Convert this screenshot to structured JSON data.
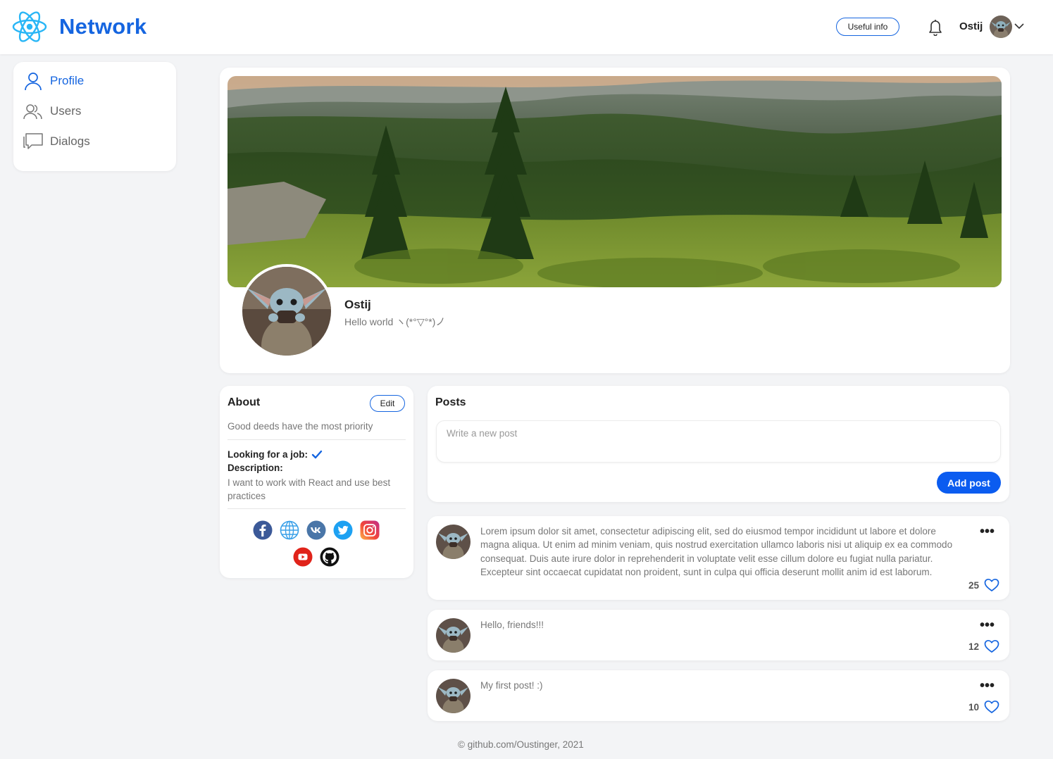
{
  "app": {
    "name": "Network"
  },
  "header": {
    "useful_info_label": "Useful info",
    "user_name": "Ostij"
  },
  "sidebar": {
    "items": [
      {
        "label": "Profile",
        "icon": "user-icon",
        "active": true
      },
      {
        "label": "Users",
        "icon": "users-icon",
        "active": false
      },
      {
        "label": "Dialogs",
        "icon": "chat-icon",
        "active": false
      }
    ]
  },
  "profile": {
    "name": "Ostij",
    "status": "Hello world  ヽ(*°▽°*)ノ"
  },
  "about": {
    "title": "About",
    "edit_label": "Edit",
    "about_me": "Good deeds have the most priority",
    "looking_for_job_label": "Looking for a job:",
    "looking_for_job": true,
    "description_label": "Description:",
    "description": "I want to work with React and use best practices",
    "socials": [
      "facebook-icon",
      "website-icon",
      "vk-icon",
      "twitter-icon",
      "instagram-icon",
      "youtube-icon",
      "github-icon"
    ]
  },
  "posts": {
    "title": "Posts",
    "input_placeholder": "Write a new post",
    "add_label": "Add post",
    "items": [
      {
        "text": "Lorem ipsum dolor sit amet, consectetur adipiscing elit, sed do eiusmod tempor incididunt ut labore et dolore magna aliqua. Ut enim ad minim veniam, quis nostrud exercitation ullamco laboris nisi ut aliquip ex ea commodo consequat. Duis aute irure dolor in reprehenderit in voluptate velit esse cillum dolore eu fugiat nulla pariatur. Excepteur sint occaecat cupidatat non proident, sunt in culpa qui officia deserunt mollit anim id est laborum.",
        "likes": "25"
      },
      {
        "text": "Hello, friends!!!",
        "likes": "12"
      },
      {
        "text": "My first post! :)",
        "likes": "10"
      }
    ]
  },
  "footer": {
    "text": "© github.com/Oustinger, 2021"
  },
  "colors": {
    "accent": "#1565e0",
    "button": "#0b5cf0",
    "background": "#f3f4f6"
  }
}
